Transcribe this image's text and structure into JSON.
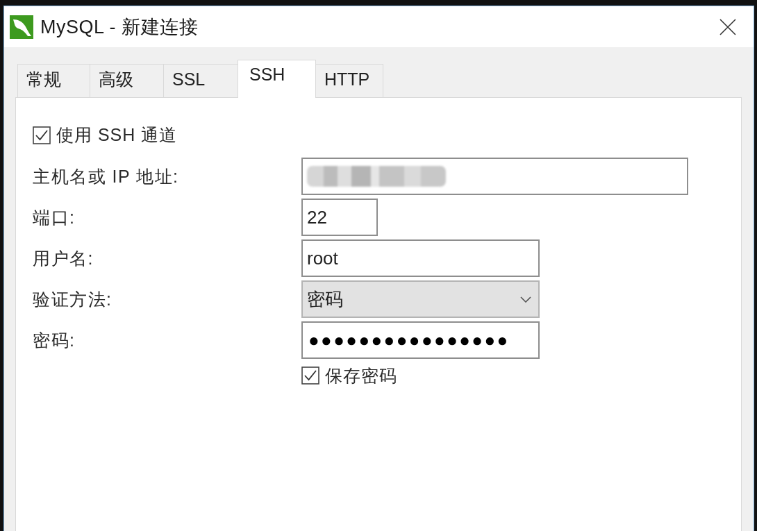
{
  "window": {
    "title": "MySQL - 新建连接"
  },
  "tabs": [
    {
      "label": "常规",
      "selected": false
    },
    {
      "label": "高级",
      "selected": false
    },
    {
      "label": "SSL",
      "selected": false
    },
    {
      "label": "SSH",
      "selected": true
    },
    {
      "label": "HTTP",
      "selected": false
    }
  ],
  "use_ssh_tunnel": {
    "label": "使用 SSH 通道",
    "checked": true
  },
  "host": {
    "label": "主机名或 IP 地址:",
    "value_blurred": true
  },
  "port": {
    "label": "端口:",
    "value": "22"
  },
  "username": {
    "label": "用户名:",
    "value": "root"
  },
  "auth_method": {
    "label": "验证方法:",
    "value": "密码"
  },
  "password": {
    "label": "密码:",
    "value": "●●●●●●●●●●●●●●●●"
  },
  "save_password": {
    "label": "保存密码",
    "checked": true
  }
}
